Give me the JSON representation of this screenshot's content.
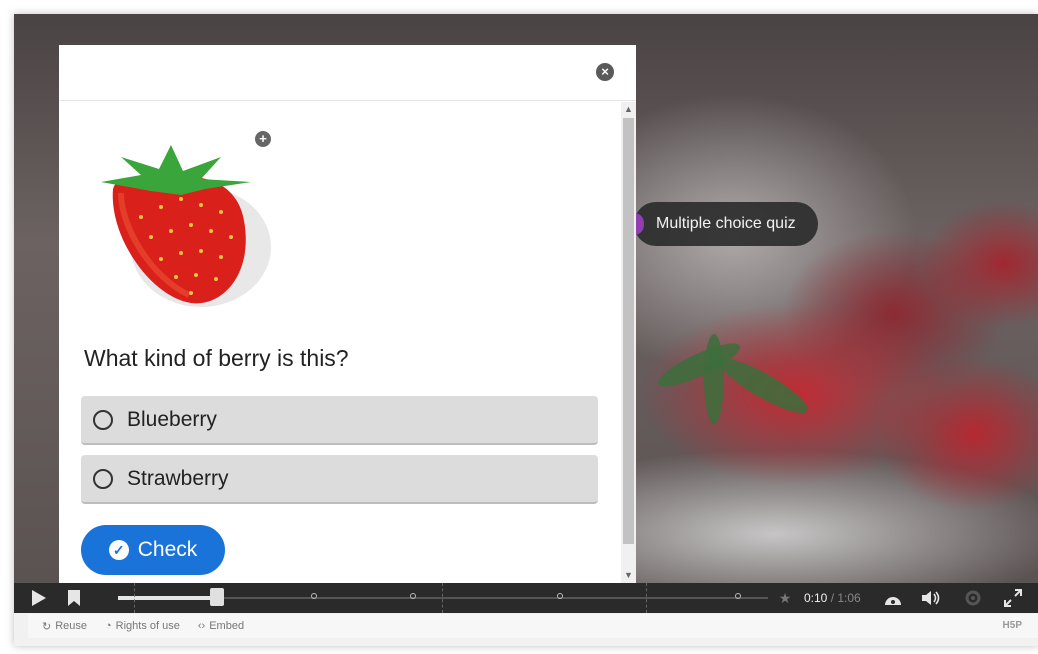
{
  "video": {
    "quiz_label": "Multiple choice quiz",
    "time_current": "0:10",
    "time_separator": " / ",
    "time_total": "1:06"
  },
  "controls": {
    "play_icon": "play-icon",
    "bookmark_icon": "bookmark-icon",
    "star_icon": "star-icon",
    "speed_icon": "speed-icon",
    "volume_icon": "volume-icon",
    "settings_icon": "gear-icon",
    "fullscreen_icon": "fullscreen-icon"
  },
  "footer": {
    "reuse": "Reuse",
    "rights": "Rights of use",
    "embed": "Embed",
    "brand": "H5P"
  },
  "dialog": {
    "close_glyph": "×",
    "zoom_glyph": "+",
    "question": "What kind of berry is this?",
    "answers": [
      {
        "label": "Blueberry"
      },
      {
        "label": "Strawberry"
      }
    ],
    "check_label": "Check",
    "check_glyph": "✓"
  },
  "colors": {
    "accent": "#1a73d9",
    "answer_bg": "#dcdcdc",
    "quiz_dot": "#8f3fb0"
  }
}
